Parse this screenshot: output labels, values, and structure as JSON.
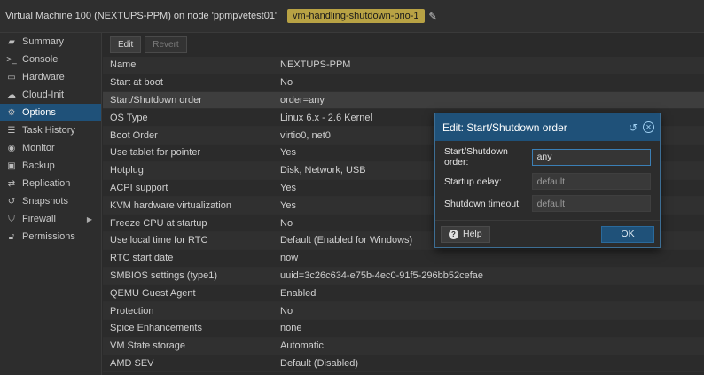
{
  "titlebar": {
    "title": "Virtual Machine 100 (NEXTUPS-PPM) on node 'ppmpvetest01'",
    "tag": "vm-handling-shutdown-prio-1"
  },
  "sidebar": {
    "items": [
      {
        "label": "Summary",
        "icon": "book-icon"
      },
      {
        "label": "Console",
        "icon": "terminal-icon"
      },
      {
        "label": "Hardware",
        "icon": "monitor-icon"
      },
      {
        "label": "Cloud-Init",
        "icon": "cloud-icon"
      },
      {
        "label": "Options",
        "icon": "gear-icon",
        "active": true
      },
      {
        "label": "Task History",
        "icon": "list-icon"
      },
      {
        "label": "Monitor",
        "icon": "eye-icon"
      },
      {
        "label": "Backup",
        "icon": "floppy-icon"
      },
      {
        "label": "Replication",
        "icon": "retweet-icon"
      },
      {
        "label": "Snapshots",
        "icon": "history-icon"
      },
      {
        "label": "Firewall",
        "icon": "shield-icon"
      },
      {
        "label": "Permissions",
        "icon": "unlock-icon"
      }
    ]
  },
  "toolbar": {
    "edit_label": "Edit",
    "revert_label": "Revert"
  },
  "options": [
    {
      "key": "Name",
      "value": "NEXTUPS-PPM"
    },
    {
      "key": "Start at boot",
      "value": "No"
    },
    {
      "key": "Start/Shutdown order",
      "value": "order=any"
    },
    {
      "key": "OS Type",
      "value": "Linux 6.x - 2.6 Kernel"
    },
    {
      "key": "Boot Order",
      "value": "virtio0, net0"
    },
    {
      "key": "Use tablet for pointer",
      "value": "Yes"
    },
    {
      "key": "Hotplug",
      "value": "Disk, Network, USB"
    },
    {
      "key": "ACPI support",
      "value": "Yes"
    },
    {
      "key": "KVM hardware virtualization",
      "value": "Yes"
    },
    {
      "key": "Freeze CPU at startup",
      "value": "No"
    },
    {
      "key": "Use local time for RTC",
      "value": "Default (Enabled for Windows)"
    },
    {
      "key": "RTC start date",
      "value": "now"
    },
    {
      "key": "SMBIOS settings (type1)",
      "value": "uuid=3c26c634-e75b-4ec0-91f5-296bb52cefae"
    },
    {
      "key": "QEMU Guest Agent",
      "value": "Enabled"
    },
    {
      "key": "Protection",
      "value": "No"
    },
    {
      "key": "Spice Enhancements",
      "value": "none"
    },
    {
      "key": "VM State storage",
      "value": "Automatic"
    },
    {
      "key": "AMD SEV",
      "value": "Default (Disabled)"
    }
  ],
  "dialog": {
    "title": "Edit: Start/Shutdown order",
    "fields": {
      "order_label": "Start/Shutdown order:",
      "order_value": "any",
      "startup_label": "Startup delay:",
      "startup_placeholder": "default",
      "shutdown_label": "Shutdown timeout:",
      "shutdown_placeholder": "default"
    },
    "help_label": "Help",
    "ok_label": "OK"
  },
  "colors": {
    "accent": "#1f5179",
    "tag": "#b8a244",
    "background": "#2a2a2a"
  }
}
